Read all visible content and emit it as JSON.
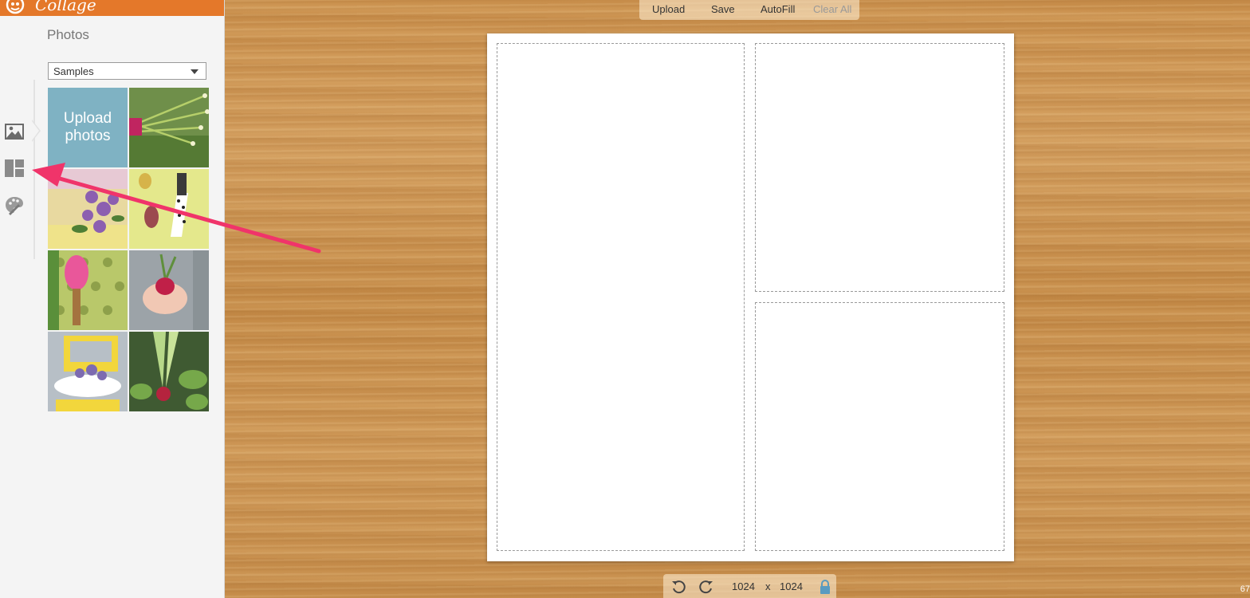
{
  "app": {
    "name": "Collage"
  },
  "sidebar": {
    "title": "Photos",
    "source_select": {
      "value": "Samples"
    },
    "upload_tile_label_line1": "Upload",
    "upload_tile_label_line2": "photos",
    "rail_items": [
      {
        "icon": "image-icon"
      },
      {
        "icon": "layout-icon"
      },
      {
        "icon": "palette-icon"
      }
    ],
    "thumbnails": [
      {
        "name": "green-onions-photo"
      },
      {
        "name": "flowers-bench-photo"
      },
      {
        "name": "garden-tools-photo"
      },
      {
        "name": "pink-trowel-photo"
      },
      {
        "name": "radish-hands-photo"
      },
      {
        "name": "yellow-chair-planter-photo"
      },
      {
        "name": "sprouting-onion-photo"
      }
    ]
  },
  "toolbar": {
    "upload": "Upload",
    "save": "Save",
    "autofill": "AutoFill",
    "clear_all": "Clear All"
  },
  "bottombar": {
    "width": "1024",
    "separator": "x",
    "height": "1024"
  },
  "corner_text": "67",
  "colors": {
    "brand_orange": "#e4782a",
    "upload_tile": "#7fb2c3",
    "annotation_arrow": "#f0346a",
    "lock_icon": "#5a9bc0"
  }
}
